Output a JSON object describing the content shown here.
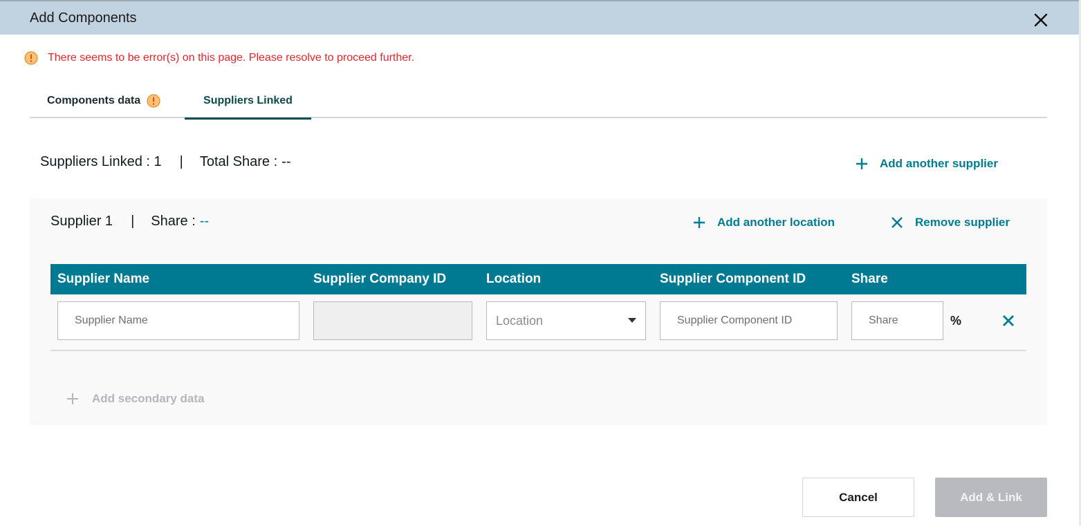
{
  "dialog": {
    "title": "Add Components",
    "close_icon": "close-icon"
  },
  "error": {
    "icon": "warning-icon",
    "message": "There seems to be error(s) on this page. Please resolve to proceed further."
  },
  "tabs": [
    {
      "label": "Components data",
      "has_warning": true,
      "active": false
    },
    {
      "label": "Suppliers Linked",
      "active": true
    }
  ],
  "summary": {
    "linked_label": "Suppliers Linked : 1",
    "separator": "|",
    "total_share_label": "Total Share :",
    "total_share_value": "--",
    "add_supplier_label": "Add another supplier"
  },
  "supplier": {
    "title": "Supplier 1",
    "separator": "|",
    "share_label": "Share :",
    "share_value": "--",
    "add_location_label": "Add another location",
    "remove_label": "Remove supplier",
    "columns": [
      "Supplier Name",
      "Supplier Company ID",
      "Location",
      "Supplier Component ID",
      "Share"
    ],
    "row": {
      "supplier_name_placeholder": "Supplier Name",
      "supplier_company_id": "",
      "location_placeholder": "Location",
      "component_id_placeholder": "Supplier Component ID",
      "share_placeholder": "Share",
      "percent": "%"
    },
    "add_secondary_label": "Add secondary data"
  },
  "footer": {
    "cancel_label": "Cancel",
    "add_link_label": "Add & Link"
  },
  "colors": {
    "titlebar": "#c1d3e0",
    "accent": "#007c91",
    "table_header": "#007a92",
    "error": "#e0262b",
    "warning": "#f6a623",
    "disabled_button": "#b9bac0"
  }
}
